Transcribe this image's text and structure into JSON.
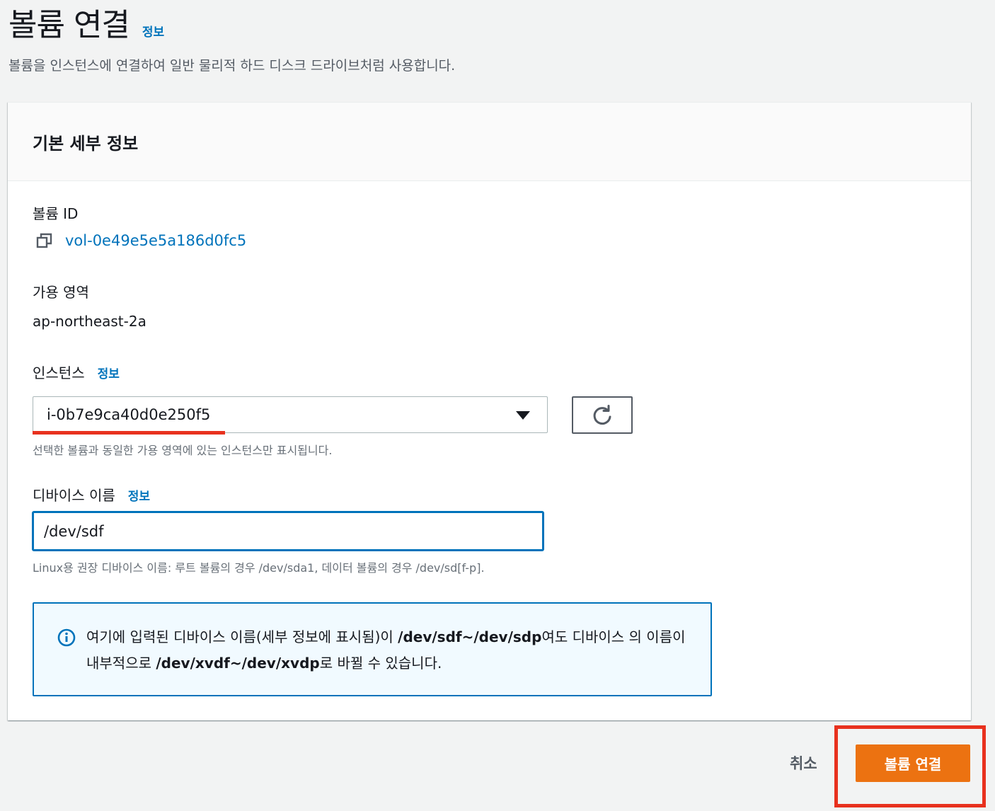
{
  "header": {
    "title": "볼륨 연결",
    "info_link": "정보",
    "description": "볼륨을 인스턴스에 연결하여 일반 물리적 하드 디스크 드라이브처럼 사용합니다."
  },
  "card": {
    "title": "기본 세부 정보"
  },
  "volume": {
    "label": "볼륨 ID",
    "id": "vol-0e49e5e5a186d0fc5",
    "copy_icon": "copy-icon"
  },
  "availability_zone": {
    "label": "가용 영역",
    "value": "ap-northeast-2a"
  },
  "instance": {
    "label": "인스턴스",
    "info_link": "정보",
    "selected": "i-0b7e9ca40d0e250f5",
    "hint": "선택한 볼륨과 동일한 가용 영역에 있는 인스턴스만 표시됩니다.",
    "refresh_icon": "refresh-icon"
  },
  "device": {
    "label": "디바이스 이름",
    "info_link": "정보",
    "value": "/dev/sdf",
    "hint": "Linux용 권장 디바이스 이름: 루트 볼륨의 경우 /dev/sda1, 데이터 볼륨의 경우 /dev/sd[f-p]."
  },
  "alert": {
    "icon": "info-icon",
    "text_1": "여기에 입력된 디바이스 이름(세부 정보에 표시됨)이 ",
    "bold_1": "/dev/sdf~/dev/sdp",
    "text_2": "여도 디바이스 의 이름이 내부적으로 ",
    "bold_2": "/dev/xvdf~/dev/xvdp",
    "text_3": "로 바뀔 수 있습니다."
  },
  "footer": {
    "cancel_label": "취소",
    "submit_label": "볼륨 연결"
  },
  "colors": {
    "link": "#0073bb",
    "primary": "#ec7211",
    "annotation": "#e8311e",
    "alert_bg": "#f1faff"
  }
}
